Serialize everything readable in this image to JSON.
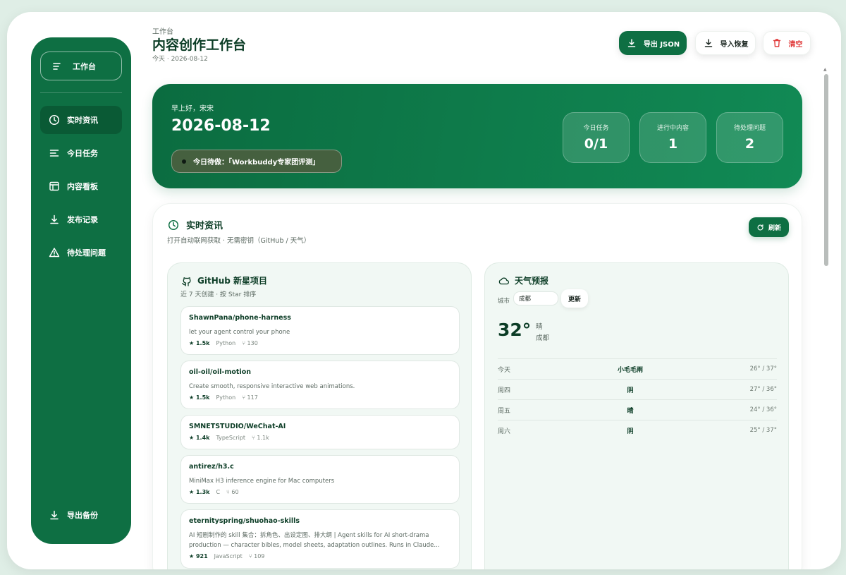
{
  "sidebar": {
    "brand": "工作台",
    "items": [
      {
        "label": "实时资讯",
        "icon": "clock-icon",
        "active": true
      },
      {
        "label": "今日任务",
        "icon": "lines-icon",
        "active": false
      },
      {
        "label": "内容看板",
        "icon": "layout-icon",
        "active": false
      },
      {
        "label": "发布记录",
        "icon": "download-icon",
        "active": false
      },
      {
        "label": "待处理问题",
        "icon": "warning-icon",
        "active": false
      }
    ],
    "footer": {
      "label": "导出备份",
      "icon": "download-icon"
    }
  },
  "header": {
    "small": "工作台",
    "title": "内容创作工作台",
    "date": "今天 · 2026-08-12",
    "buttons": {
      "export": "导出 JSON",
      "import": "导入恢复",
      "clear": "清空"
    }
  },
  "hero": {
    "greeting": "早上好，宋宋",
    "date": "2026-08-12",
    "todo": "今日待做：「Workbuddy专家团评测」",
    "stats": [
      {
        "label": "今日任务",
        "value": "0/1"
      },
      {
        "label": "进行中内容",
        "value": "1"
      },
      {
        "label": "待处理问题",
        "value": "2"
      }
    ]
  },
  "news": {
    "title": "实时资讯",
    "subtitle": "打开自动联网获取 · 无需密钥（GitHub / 天气）",
    "refresh": "刷新",
    "github": {
      "title": "GitHub 新星项目",
      "subtitle": "近 7 天创建 · 按 Star 排序",
      "repos": [
        {
          "name": "ShawnPana/phone-harness",
          "desc": "let your agent control your phone",
          "stars": "★ 1.5k",
          "lang": "Python",
          "forks": "⑂ 130"
        },
        {
          "name": "oil-oil/oil-motion",
          "desc": "Create smooth, responsive interactive web animations.",
          "stars": "★ 1.5k",
          "lang": "Python",
          "forks": "⑂ 117"
        },
        {
          "name": "SMNETSTUDIO/WeChat-AI",
          "desc": "",
          "stars": "★ 1.4k",
          "lang": "TypeScript",
          "forks": "⑂ 1.1k"
        },
        {
          "name": "antirez/h3.c",
          "desc": "MiniMax H3 inference engine for Mac computers",
          "stars": "★ 1.3k",
          "lang": "C",
          "forks": "⑂ 60"
        },
        {
          "name": "eternityspring/shuohao-skills",
          "desc": "AI 短剧制作的 skill 集合：拆角色、出设定图、排大纲 | Agent skills for AI short-drama production — character bibles, model sheets, adaptation outlines. Runs in Claude...",
          "stars": "★ 921",
          "lang": "JavaScript",
          "forks": "⑂ 109"
        }
      ]
    },
    "weather": {
      "title": "天气预报",
      "city_label": "城市",
      "city_value": "成都",
      "update": "更新",
      "temp": "32°",
      "condition": "晴",
      "city": "成都",
      "forecast": [
        {
          "day": "今天",
          "cond": "小毛毛雨",
          "range": "26° / 37°"
        },
        {
          "day": "周四",
          "cond": "阴",
          "range": "27° / 36°"
        },
        {
          "day": "周五",
          "cond": "晴",
          "range": "24° / 36°"
        },
        {
          "day": "周六",
          "cond": "阴",
          "range": "25° / 37°"
        }
      ]
    }
  }
}
